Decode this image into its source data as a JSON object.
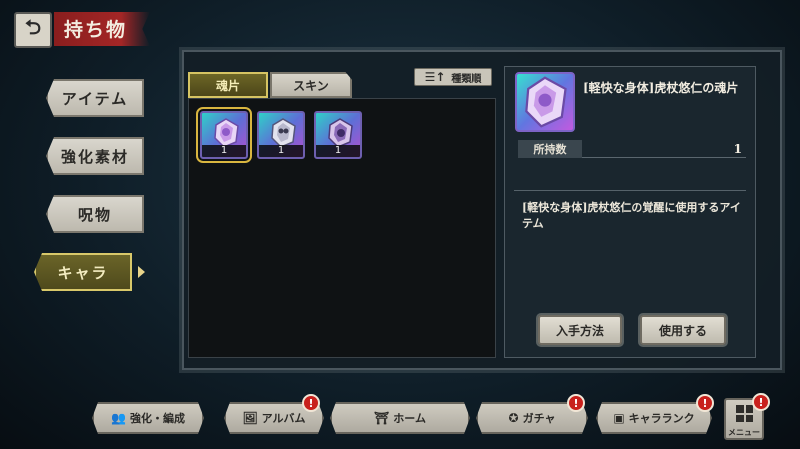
{
  "header": {
    "back_icon": "back-arrow-icon",
    "title": "持ち物"
  },
  "categories": [
    {
      "label": "アイテム",
      "active": false
    },
    {
      "label": "強化素材",
      "active": false
    },
    {
      "label": "呪物",
      "active": false
    },
    {
      "label": "キャラ",
      "active": true
    }
  ],
  "tabs": [
    {
      "label": "魂片",
      "active": true
    },
    {
      "label": "スキン",
      "active": false
    }
  ],
  "sort": {
    "icon": "sort-icon",
    "label": "種類順"
  },
  "items": [
    {
      "count": "1",
      "selected": true
    },
    {
      "count": "1",
      "selected": false
    },
    {
      "count": "1",
      "selected": false
    }
  ],
  "detail": {
    "name": "[軽快な身体]虎杖悠仁の魂片",
    "owned_label": "所持数",
    "owned_value": "1",
    "description": "[軽快な身体]虎杖悠仁の覚醒に使用するアイテム",
    "how_to_get_label": "入手方法",
    "use_label": "使用する"
  },
  "bottom_nav": [
    {
      "label": "強化・編成",
      "icon": "party-icon",
      "badge": ""
    },
    {
      "label": "アルバム",
      "icon": "album-icon",
      "badge": "!"
    },
    {
      "label": "ホーム",
      "icon": "home-icon",
      "badge": ""
    },
    {
      "label": "ガチャ",
      "icon": "gacha-icon",
      "badge": "!"
    },
    {
      "label": "キャラランク",
      "icon": "rank-icon",
      "badge": "!"
    }
  ],
  "menu": {
    "label": "メニュー",
    "icon": "menu-grid-icon",
    "badge": "!"
  },
  "colors": {
    "accent_gold": "#d6c463",
    "title_red": "#a32626",
    "badge_red": "#c8201c"
  }
}
